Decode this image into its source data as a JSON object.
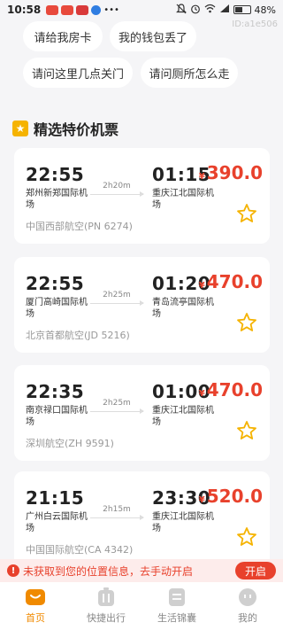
{
  "status_bar": {
    "time": "10:58",
    "battery": "48%"
  },
  "id_text": "ID:a1e506",
  "quick_questions": [
    "请给我房卡",
    "我的钱包丢了",
    "请问这里几点关门",
    "请问厕所怎么走"
  ],
  "section": {
    "title": "精选特价机票",
    "icon": "star-badge-icon"
  },
  "flights": [
    {
      "dep_time": "22:55",
      "dep_airport": "郑州新郑国际机场",
      "duration": "2h20m",
      "arr_time": "01:15",
      "arr_airport": "重庆江北国际机场",
      "currency": "¥",
      "price": "390.0",
      "airline": "中国西部航空(PN 6274)"
    },
    {
      "dep_time": "22:55",
      "dep_airport": "厦门高崎国际机场",
      "duration": "2h25m",
      "arr_time": "01:20",
      "arr_airport": "青岛流亭国际机场",
      "currency": "¥",
      "price": "470.0",
      "airline": "北京首都航空(JD 5216)"
    },
    {
      "dep_time": "22:35",
      "dep_airport": "南京禄口国际机场",
      "duration": "2h25m",
      "arr_time": "01:00",
      "arr_airport": "重庆江北国际机场",
      "currency": "¥",
      "price": "470.0",
      "airline": "深圳航空(ZH 9591)"
    },
    {
      "dep_time": "21:15",
      "dep_airport": "广州白云国际机场",
      "duration": "2h15m",
      "arr_time": "23:30",
      "arr_airport": "重庆江北国际机场",
      "currency": "¥",
      "price": "520.0",
      "airline": "中国国际航空(CA 4342)"
    }
  ],
  "location_banner": {
    "icon": "warning-icon",
    "text": "未获取到您的位置信息，去手动开启",
    "button": "开启"
  },
  "bottom_nav": [
    {
      "label": "首页",
      "icon": "home-icon",
      "active": true
    },
    {
      "label": "快捷出行",
      "icon": "luggage-icon",
      "active": false
    },
    {
      "label": "生活锦囊",
      "icon": "document-icon",
      "active": false
    },
    {
      "label": "我的",
      "icon": "profile-icon",
      "active": false
    }
  ],
  "colors": {
    "accent": "#e8412c",
    "brand": "#f08a00",
    "star": "#f5b301",
    "background": "#f5f5f7"
  }
}
